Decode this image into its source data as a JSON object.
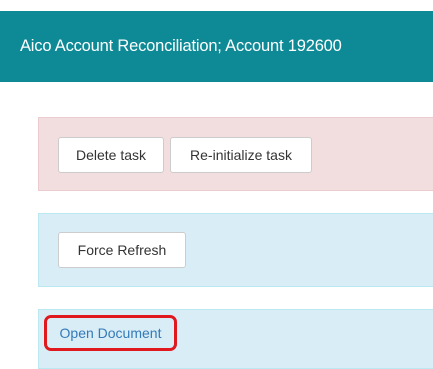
{
  "header": {
    "title": "Aico Account Reconciliation; Account 192600"
  },
  "actions": {
    "delete_label": "Delete task",
    "reinitialize_label": "Re-initialize task",
    "refresh_label": "Force Refresh",
    "open_document_label": "Open Document"
  },
  "colors": {
    "header_bg": "#0e8a96",
    "danger_panel_bg": "#f2dede",
    "info_panel_bg": "#d9edf7",
    "highlight_border": "#e0191f",
    "link_text": "#337ab7"
  }
}
